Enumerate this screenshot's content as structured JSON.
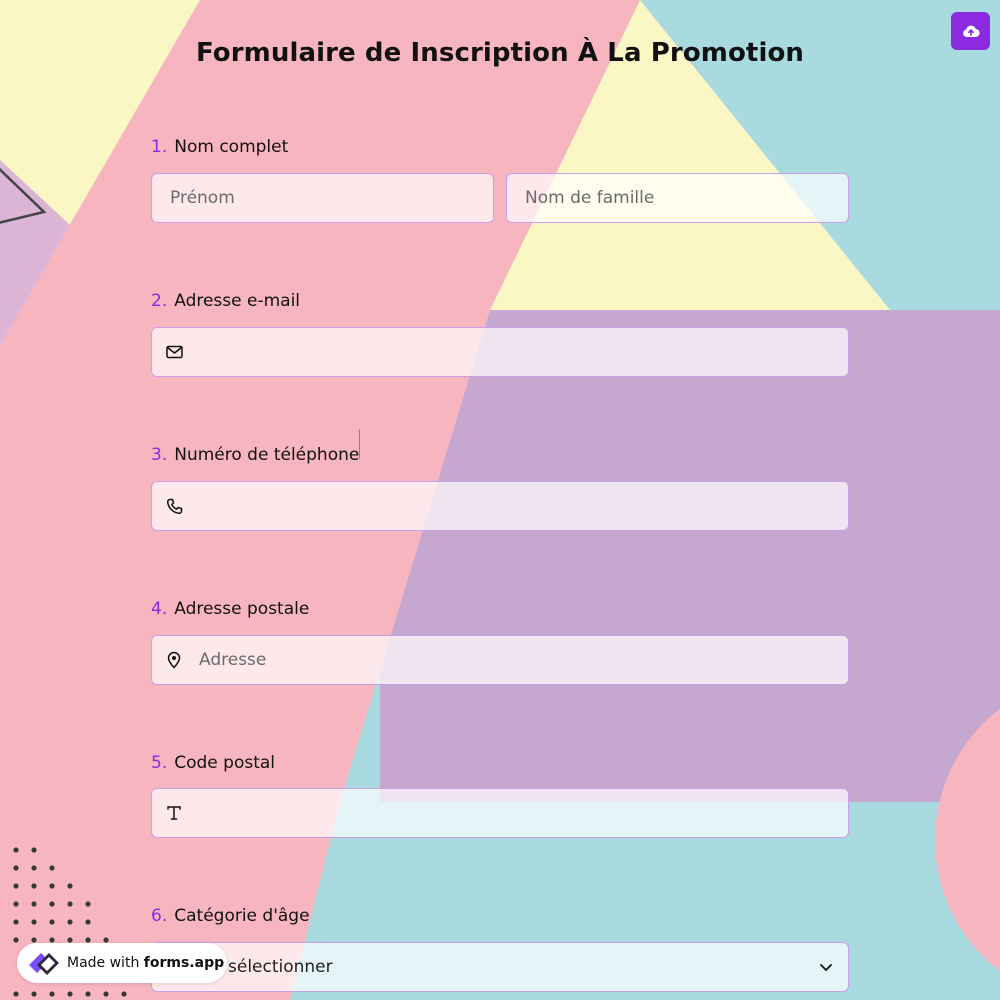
{
  "form": {
    "title": "Formulaire de Inscription À La Promotion"
  },
  "questions": [
    {
      "number": "1.",
      "label": "Nom complet"
    },
    {
      "number": "2.",
      "label": "Adresse e-mail"
    },
    {
      "number": "3.",
      "label": "Numéro de téléphone"
    },
    {
      "number": "4.",
      "label": "Adresse postale"
    },
    {
      "number": "5.",
      "label": "Code postal"
    },
    {
      "number": "6.",
      "label": "Catégorie d'âge"
    }
  ],
  "fields": {
    "first_name": {
      "placeholder": "Prénom",
      "value": ""
    },
    "last_name": {
      "placeholder": "Nom de famille",
      "value": ""
    },
    "email": {
      "placeholder": "",
      "value": ""
    },
    "phone": {
      "placeholder": "",
      "value": ""
    },
    "address": {
      "placeholder": "Adresse",
      "value": ""
    },
    "postal_code": {
      "placeholder": "",
      "value": ""
    },
    "age_category": {
      "selected": "sélectionner"
    }
  },
  "icons": {
    "upload": "cloud-upload-icon",
    "email": "mail-icon",
    "phone": "phone-icon",
    "address": "map-pin-icon",
    "postal_code": "text-type-icon",
    "dropdown": "chevron-down-icon",
    "brand": "forms-app-logo"
  },
  "badge": {
    "prefix": "Made with ",
    "brand": "forms.app"
  },
  "colors": {
    "accent": "#8a2be2",
    "pink": "#f7b6bf",
    "yellow": "#fbf7c5",
    "teal": "#a8dadf",
    "lavender": "#c5a7d0"
  }
}
